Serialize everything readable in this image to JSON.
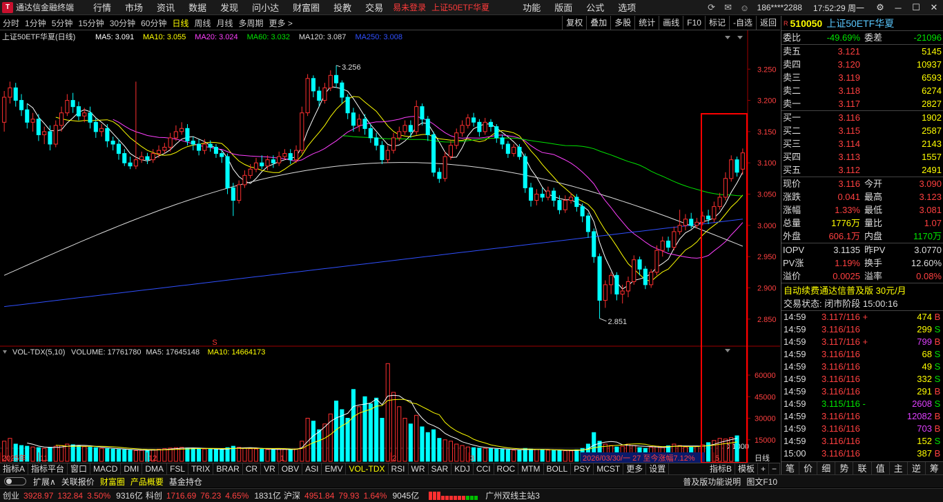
{
  "titlebar": {
    "app_title": "通达信金融终端",
    "menu": [
      "行情",
      "市场",
      "资讯",
      "数据",
      "发现",
      "问小达",
      "财富圈",
      "投教",
      "交易"
    ],
    "login": "易未登录",
    "current": "上证50ETF华夏",
    "right_menu": [
      "功能",
      "版面",
      "公式",
      "选项"
    ],
    "account": "186****2288",
    "time": "17:52:29",
    "weekday": "周一"
  },
  "periods": [
    "分时",
    "1分钟",
    "5分钟",
    "15分钟",
    "30分钟",
    "60分钟",
    "日线",
    "周线",
    "月线",
    "多周期",
    "更多 >"
  ],
  "active_period": "日线",
  "right_tools": [
    "复权",
    "叠加",
    "多股",
    "统计",
    "画线",
    "F10",
    "标记",
    "-自选",
    "返回"
  ],
  "chart_header": {
    "title": "上证50ETF华夏(日线)",
    "mas": [
      {
        "label": "MA5: 3.091",
        "color": "#ffffff"
      },
      {
        "label": "MA10: 3.055",
        "color": "#ffff00"
      },
      {
        "label": "MA20: 3.024",
        "color": "#ff40ff"
      },
      {
        "label": "MA60: 3.032",
        "color": "#00e400"
      },
      {
        "label": "MA120: 3.087",
        "color": "#dddddd"
      },
      {
        "label": "MA250: 3.008",
        "color": "#3050ff"
      }
    ]
  },
  "vol_header": {
    "title": "VOL-TDX(5,10)",
    "items": [
      {
        "label": "VOLUME: 17761780",
        "color": "#dddddd"
      },
      {
        "label": "MA5: 17645148",
        "color": "#dddddd"
      },
      {
        "label": "MA10: 14664173",
        "color": "#ffff00"
      }
    ]
  },
  "chart_data": {
    "type": "candlestick",
    "price_axis": {
      "ticks": [
        "3.250",
        "3.200",
        "3.150",
        "3.100",
        "3.050",
        "3.000",
        "2.950",
        "2.900",
        "2.850"
      ],
      "ylim": [
        2.81,
        3.29
      ]
    },
    "volume_axis": {
      "ticks": [
        "60000",
        "45000",
        "30000",
        "15000"
      ],
      "unit": "X1000",
      "ylim": [
        0,
        72000
      ]
    },
    "annotations": {
      "high": "3.256",
      "low": "2.851"
    },
    "x_labels": [
      "2025年",
      "11",
      "12",
      "1",
      "2",
      "3",
      "5"
    ],
    "ohlc": [
      [
        3.165,
        3.205,
        3.215,
        3.15
      ],
      [
        3.205,
        3.22,
        3.23,
        3.195
      ],
      [
        3.22,
        3.2,
        3.228,
        3.19
      ],
      [
        3.2,
        3.185,
        3.21,
        3.175
      ],
      [
        3.185,
        3.165,
        3.195,
        3.155
      ],
      [
        3.165,
        3.17,
        3.18,
        3.15
      ],
      [
        3.17,
        3.145,
        3.178,
        3.135
      ],
      [
        3.145,
        3.15,
        3.158,
        3.13
      ],
      [
        3.15,
        3.13,
        3.16,
        3.12
      ],
      [
        3.13,
        3.16,
        3.168,
        3.125
      ],
      [
        3.16,
        3.18,
        3.19,
        3.15
      ],
      [
        3.18,
        3.2,
        3.21,
        3.175
      ],
      [
        3.2,
        3.19,
        3.212,
        3.18
      ],
      [
        3.19,
        3.175,
        3.198,
        3.168
      ],
      [
        3.175,
        3.18,
        3.188,
        3.165
      ],
      [
        3.18,
        3.165,
        3.19,
        3.155
      ],
      [
        3.165,
        3.15,
        3.172,
        3.14
      ],
      [
        3.15,
        3.155,
        3.162,
        3.142
      ],
      [
        3.155,
        3.135,
        3.162,
        3.125
      ],
      [
        3.135,
        3.13,
        3.142,
        3.12
      ],
      [
        3.13,
        3.115,
        3.138,
        3.105
      ],
      [
        3.115,
        3.1,
        3.122,
        3.095
      ],
      [
        3.1,
        3.095,
        3.11,
        3.09
      ],
      [
        3.095,
        3.105,
        3.23,
        3.09
      ],
      [
        3.105,
        3.11,
        3.118,
        3.1
      ],
      [
        3.11,
        3.105,
        3.116,
        3.098
      ],
      [
        3.105,
        3.115,
        3.122,
        3.1
      ],
      [
        3.115,
        3.12,
        3.128,
        3.108
      ],
      [
        3.12,
        3.125,
        3.132,
        3.115
      ],
      [
        3.125,
        3.14,
        3.148,
        3.118
      ],
      [
        3.14,
        3.15,
        3.16,
        3.135
      ],
      [
        3.15,
        3.155,
        3.165,
        3.145
      ],
      [
        3.155,
        3.135,
        3.162,
        3.128
      ],
      [
        3.135,
        3.13,
        3.142,
        3.12
      ],
      [
        3.13,
        3.12,
        3.138,
        3.112
      ],
      [
        3.12,
        3.13,
        3.138,
        3.114
      ],
      [
        3.13,
        3.125,
        3.136,
        3.118
      ],
      [
        3.125,
        3.115,
        3.13,
        3.108
      ],
      [
        3.115,
        3.11,
        3.12,
        3.1
      ],
      [
        3.11,
        3.06,
        3.115,
        3.05
      ],
      [
        3.06,
        3.04,
        3.068,
        3.015
      ],
      [
        3.04,
        3.065,
        3.072,
        3.035
      ],
      [
        3.065,
        3.08,
        3.088,
        3.06
      ],
      [
        3.08,
        3.09,
        3.098,
        3.075
      ],
      [
        3.09,
        3.1,
        3.108,
        3.085
      ],
      [
        3.1,
        3.095,
        3.112,
        3.09
      ],
      [
        3.095,
        3.105,
        3.112,
        3.088
      ],
      [
        3.105,
        3.1,
        3.112,
        3.092
      ],
      [
        3.1,
        3.11,
        3.118,
        3.095
      ],
      [
        3.11,
        3.115,
        3.122,
        3.105
      ],
      [
        3.115,
        3.105,
        3.122,
        3.098
      ],
      [
        3.105,
        3.12,
        3.128,
        3.1
      ],
      [
        3.12,
        3.18,
        3.19,
        3.115
      ],
      [
        3.18,
        3.235,
        3.242,
        3.175
      ],
      [
        3.235,
        3.215,
        3.24,
        3.205
      ],
      [
        3.215,
        3.2,
        3.222,
        3.19
      ],
      [
        3.2,
        3.22,
        3.228,
        3.195
      ],
      [
        3.22,
        3.24,
        3.248,
        3.215
      ],
      [
        3.24,
        3.228,
        3.256,
        3.22
      ],
      [
        3.228,
        3.205,
        3.232,
        3.195
      ],
      [
        3.205,
        3.18,
        3.21,
        3.17
      ],
      [
        3.18,
        3.16,
        3.188,
        3.15
      ],
      [
        3.16,
        3.17,
        3.178,
        3.15
      ],
      [
        3.17,
        3.155,
        3.178,
        3.145
      ],
      [
        3.155,
        3.14,
        3.162,
        3.132
      ],
      [
        3.14,
        3.128,
        3.148,
        3.12
      ],
      [
        3.128,
        3.105,
        3.135,
        3.098
      ],
      [
        3.105,
        3.12,
        3.128,
        3.1
      ],
      [
        3.12,
        3.14,
        3.148,
        3.115
      ],
      [
        3.14,
        3.15,
        3.158,
        3.135
      ],
      [
        3.15,
        3.16,
        3.168,
        3.145
      ],
      [
        3.16,
        3.15,
        3.168,
        3.14
      ],
      [
        3.15,
        3.19,
        3.2,
        3.145
      ],
      [
        3.19,
        3.17,
        3.195,
        3.16
      ],
      [
        3.17,
        3.145,
        3.175,
        3.135
      ],
      [
        3.145,
        3.085,
        3.15,
        3.078
      ],
      [
        3.085,
        3.075,
        3.092,
        3.068
      ],
      [
        3.075,
        3.11,
        3.118,
        3.07
      ],
      [
        3.11,
        3.128,
        3.135,
        3.105
      ],
      [
        3.128,
        3.148,
        3.155,
        3.122
      ],
      [
        3.148,
        3.16,
        3.168,
        3.142
      ],
      [
        3.16,
        3.172,
        3.178,
        3.155
      ],
      [
        3.172,
        3.165,
        3.18,
        3.158
      ],
      [
        3.165,
        3.15,
        3.17,
        3.142
      ],
      [
        3.15,
        3.165,
        3.172,
        3.145
      ],
      [
        3.165,
        3.158,
        3.17,
        3.15
      ],
      [
        3.158,
        3.14,
        3.162,
        3.132
      ],
      [
        3.14,
        3.13,
        3.145,
        3.122
      ],
      [
        3.13,
        3.115,
        3.135,
        3.108
      ],
      [
        3.115,
        3.125,
        3.13,
        3.11
      ],
      [
        3.125,
        3.11,
        3.13,
        3.105
      ],
      [
        3.11,
        3.06,
        3.115,
        3.052
      ],
      [
        3.06,
        3.04,
        3.068,
        3.03
      ],
      [
        3.04,
        3.05,
        3.058,
        3.032
      ],
      [
        3.05,
        3.045,
        3.06,
        3.038
      ],
      [
        3.045,
        3.055,
        3.062,
        3.04
      ],
      [
        3.055,
        3.04,
        3.06,
        3.03
      ],
      [
        3.04,
        3.025,
        3.048,
        3.018
      ],
      [
        3.025,
        3.04,
        3.048,
        3.02
      ],
      [
        3.04,
        3.045,
        3.052,
        3.035
      ],
      [
        3.045,
        3.03,
        3.05,
        3.022
      ],
      [
        3.03,
        3.015,
        3.035,
        3.005
      ],
      [
        3.015,
        2.99,
        3.02,
        2.98
      ],
      [
        2.99,
        2.95,
        2.995,
        2.94
      ],
      [
        2.95,
        2.88,
        2.955,
        2.851
      ],
      [
        2.88,
        2.905,
        2.912,
        2.868
      ],
      [
        2.905,
        2.92,
        2.925,
        2.89
      ],
      [
        2.92,
        2.89,
        2.925,
        2.88
      ],
      [
        2.89,
        2.895,
        2.905,
        2.875
      ],
      [
        2.895,
        2.91,
        2.918,
        2.885
      ],
      [
        2.91,
        2.945,
        2.952,
        2.905
      ],
      [
        2.945,
        2.93,
        2.95,
        2.92
      ],
      [
        2.93,
        2.905,
        2.935,
        2.898
      ],
      [
        2.905,
        2.925,
        2.93,
        2.9
      ],
      [
        2.925,
        2.96,
        2.968,
        2.92
      ],
      [
        2.96,
        2.975,
        2.982,
        2.95
      ],
      [
        2.975,
        2.965,
        2.982,
        2.958
      ],
      [
        2.965,
        2.99,
        2.998,
        2.96
      ],
      [
        2.99,
        3.0,
        3.025,
        2.985
      ],
      [
        3.0,
        3.01,
        3.018,
        2.992
      ],
      [
        3.01,
        3.0,
        3.02,
        2.995
      ],
      [
        3.0,
        3.005,
        3.012,
        2.995
      ],
      [
        3.005,
        3.015,
        3.022,
        3.0
      ],
      [
        3.015,
        3.01,
        3.025,
        3.002
      ],
      [
        3.01,
        3.03,
        3.038,
        3.005
      ],
      [
        3.03,
        3.045,
        3.052,
        3.025
      ],
      [
        3.045,
        3.075,
        3.085,
        3.04
      ],
      [
        3.075,
        3.105,
        3.112,
        3.07
      ],
      [
        3.105,
        3.085,
        3.11,
        3.078
      ],
      [
        3.09,
        3.116,
        3.123,
        3.081
      ]
    ],
    "volume": [
      14000,
      16000,
      12000,
      11000,
      10500,
      10000,
      9500,
      9000,
      9800,
      10500,
      11000,
      12000,
      11500,
      10800,
      10200,
      9800,
      9500,
      9000,
      8800,
      8500,
      8200,
      8000,
      7800,
      7500,
      7600,
      7800,
      8200,
      8400,
      8800,
      9200,
      9500,
      9700,
      9300,
      9000,
      8800,
      8600,
      8400,
      8200,
      8000,
      9500,
      10500,
      9800,
      9200,
      8800,
      8600,
      8400,
      8200,
      8000,
      8300,
      8500,
      8100,
      8600,
      14000,
      30000,
      28000,
      22000,
      26000,
      33000,
      42000,
      36000,
      30000,
      50000,
      38000,
      45000,
      40000,
      44000,
      30000,
      68000,
      48000,
      38000,
      30000,
      26000,
      32000,
      24000,
      20000,
      22000,
      16000,
      15000,
      14000,
      12000,
      11000,
      10000,
      9500,
      9200,
      9000,
      8800,
      8500,
      8300,
      8000,
      7800,
      7600,
      9000,
      8500,
      8200,
      8000,
      7800,
      7600,
      7500,
      7400,
      7300,
      8000,
      9000,
      12000,
      20000,
      14000,
      12000,
      11000,
      10000,
      10500,
      12000,
      11000,
      9500,
      9000,
      9800,
      10500,
      9500,
      10800,
      12000,
      11000,
      10000,
      9800,
      10500,
      11500,
      13000,
      14500,
      16000,
      15500,
      16500,
      17760
    ]
  },
  "vol_marker": "S",
  "range_note": "2026/03/30/一 27 至今涨幅7.12%",
  "day_label": "日线",
  "indicator_tabs": [
    "指标A",
    "指标平台",
    "窗口",
    "MACD",
    "DMI",
    "DMA",
    "FSL",
    "TRIX",
    "BRAR",
    "CR",
    "VR",
    "OBV",
    "ASI",
    "EMV",
    "VOL-TDX",
    "RSI",
    "WR",
    "SAR",
    "KDJ",
    "CCI",
    "ROC",
    "MTM",
    "BOLL",
    "PSY",
    "MCST",
    "更多",
    "设置"
  ],
  "active_indicator": "VOL-TDX",
  "indicator_right": [
    "指标B",
    "模板",
    "+",
    "−"
  ],
  "bottom_bar": {
    "items": [
      "扩展∧",
      "关联报价",
      "财富圈",
      "产品概要",
      "基金持仓"
    ],
    "right": [
      "普及版功能说明",
      "图文F10"
    ]
  },
  "status_bar": {
    "entries": [
      {
        "label": "创业",
        "price": "3928.97",
        "chg": "132.84",
        "pct": "3.50%",
        "amt": "9316亿"
      },
      {
        "label": "科创",
        "price": "1716.69",
        "chg": "76.23",
        "pct": "4.65%",
        "amt": "1831亿"
      },
      {
        "label": "沪深",
        "price": "4951.84",
        "chg": "79.93",
        "pct": "1.64%",
        "amt": "9045亿"
      }
    ],
    "server": "广州双线主站3"
  },
  "quote": {
    "code": "510050",
    "name": "上证50ETF华夏",
    "weibi": {
      "label": "委比",
      "value": "-49.69%",
      "label2": "委差",
      "value2": "-21096"
    },
    "asks": [
      {
        "label": "卖五",
        "price": "3.121",
        "vol": "5145"
      },
      {
        "label": "卖四",
        "price": "3.120",
        "vol": "10937"
      },
      {
        "label": "卖三",
        "price": "3.119",
        "vol": "6593"
      },
      {
        "label": "卖二",
        "price": "3.118",
        "vol": "6274"
      },
      {
        "label": "卖一",
        "price": "3.117",
        "vol": "2827"
      }
    ],
    "bids": [
      {
        "label": "买一",
        "price": "3.116",
        "vol": "1902"
      },
      {
        "label": "买二",
        "price": "3.115",
        "vol": "2587"
      },
      {
        "label": "买三",
        "price": "3.114",
        "vol": "2143"
      },
      {
        "label": "买四",
        "price": "3.113",
        "vol": "1557"
      },
      {
        "label": "买五",
        "price": "3.112",
        "vol": "2491"
      }
    ],
    "stats": [
      {
        "l1": "现价",
        "v1": "3.116",
        "c1": "r",
        "l2": "今开",
        "v2": "3.090",
        "c2": "r"
      },
      {
        "l1": "涨跌",
        "v1": "0.041",
        "c1": "r",
        "l2": "最高",
        "v2": "3.123",
        "c2": "r"
      },
      {
        "l1": "涨幅",
        "v1": "1.33%",
        "c1": "r",
        "l2": "最低",
        "v2": "3.081",
        "c2": "r"
      },
      {
        "l1": "总量",
        "v1": "1776万",
        "c1": "y",
        "l2": "量比",
        "v2": "1.07",
        "c2": "r"
      },
      {
        "l1": "外盘",
        "v1": "606.1万",
        "c1": "r",
        "l2": "内盘",
        "v2": "1170万",
        "c2": "g"
      }
    ],
    "iopv": [
      {
        "l1": "IOPV",
        "v1": "3.1135",
        "c1": "w",
        "l2": "昨PV",
        "v2": "3.0770",
        "c2": "w"
      },
      {
        "l1": "PV涨",
        "v1": "1.19%",
        "c1": "r",
        "l2": "换手",
        "v2": "12.60%",
        "c2": "w"
      },
      {
        "l1": "溢价",
        "v1": "0.0025",
        "c1": "r",
        "l2": "溢率",
        "v2": "0.08%",
        "c2": "r"
      }
    ],
    "promo": "自动续费通达信普及版 30元/月",
    "status": "交易状态: 闭市阶段 15:00:16",
    "ticks": [
      {
        "t": "14:59",
        "p": "3.117/116 +",
        "pc": "r",
        "v": "474",
        "vc": "y",
        "f": "B",
        "fc": "r"
      },
      {
        "t": "14:59",
        "p": "3.116/116",
        "pc": "r",
        "v": "299",
        "vc": "y",
        "f": "S",
        "fc": "g"
      },
      {
        "t": "14:59",
        "p": "3.117/116 +",
        "pc": "r",
        "v": "799",
        "vc": "p",
        "f": "B",
        "fc": "r"
      },
      {
        "t": "14:59",
        "p": "3.116/116",
        "pc": "r",
        "v": "68",
        "vc": "y",
        "f": "S",
        "fc": "g"
      },
      {
        "t": "14:59",
        "p": "3.116/116",
        "pc": "r",
        "v": "49",
        "vc": "y",
        "f": "S",
        "fc": "g"
      },
      {
        "t": "14:59",
        "p": "3.116/116",
        "pc": "r",
        "v": "332",
        "vc": "y",
        "f": "S",
        "fc": "g"
      },
      {
        "t": "14:59",
        "p": "3.116/116",
        "pc": "r",
        "v": "291",
        "vc": "y",
        "f": "B",
        "fc": "r"
      },
      {
        "t": "14:59",
        "p": "3.115/116 -",
        "pc": "g",
        "v": "2608",
        "vc": "p",
        "f": "S",
        "fc": "g"
      },
      {
        "t": "14:59",
        "p": "3.116/116",
        "pc": "r",
        "v": "12082",
        "vc": "p",
        "f": "B",
        "fc": "r"
      },
      {
        "t": "14:59",
        "p": "3.116/116",
        "pc": "r",
        "v": "703",
        "vc": "p",
        "f": "B",
        "fc": "r"
      },
      {
        "t": "14:59",
        "p": "3.116/116",
        "pc": "r",
        "v": "152",
        "vc": "y",
        "f": "S",
        "fc": "g"
      },
      {
        "t": "15:00",
        "p": "3.116/116",
        "pc": "r",
        "v": "387",
        "vc": "y",
        "f": "B",
        "fc": "r"
      }
    ],
    "tabs": [
      "笔",
      "价",
      "细",
      "势",
      "联",
      "值",
      "主",
      "逆",
      "筹"
    ]
  },
  "colors": {
    "up": "#ff3030",
    "down": "#00ffff",
    "highlight": "#ff0000"
  }
}
